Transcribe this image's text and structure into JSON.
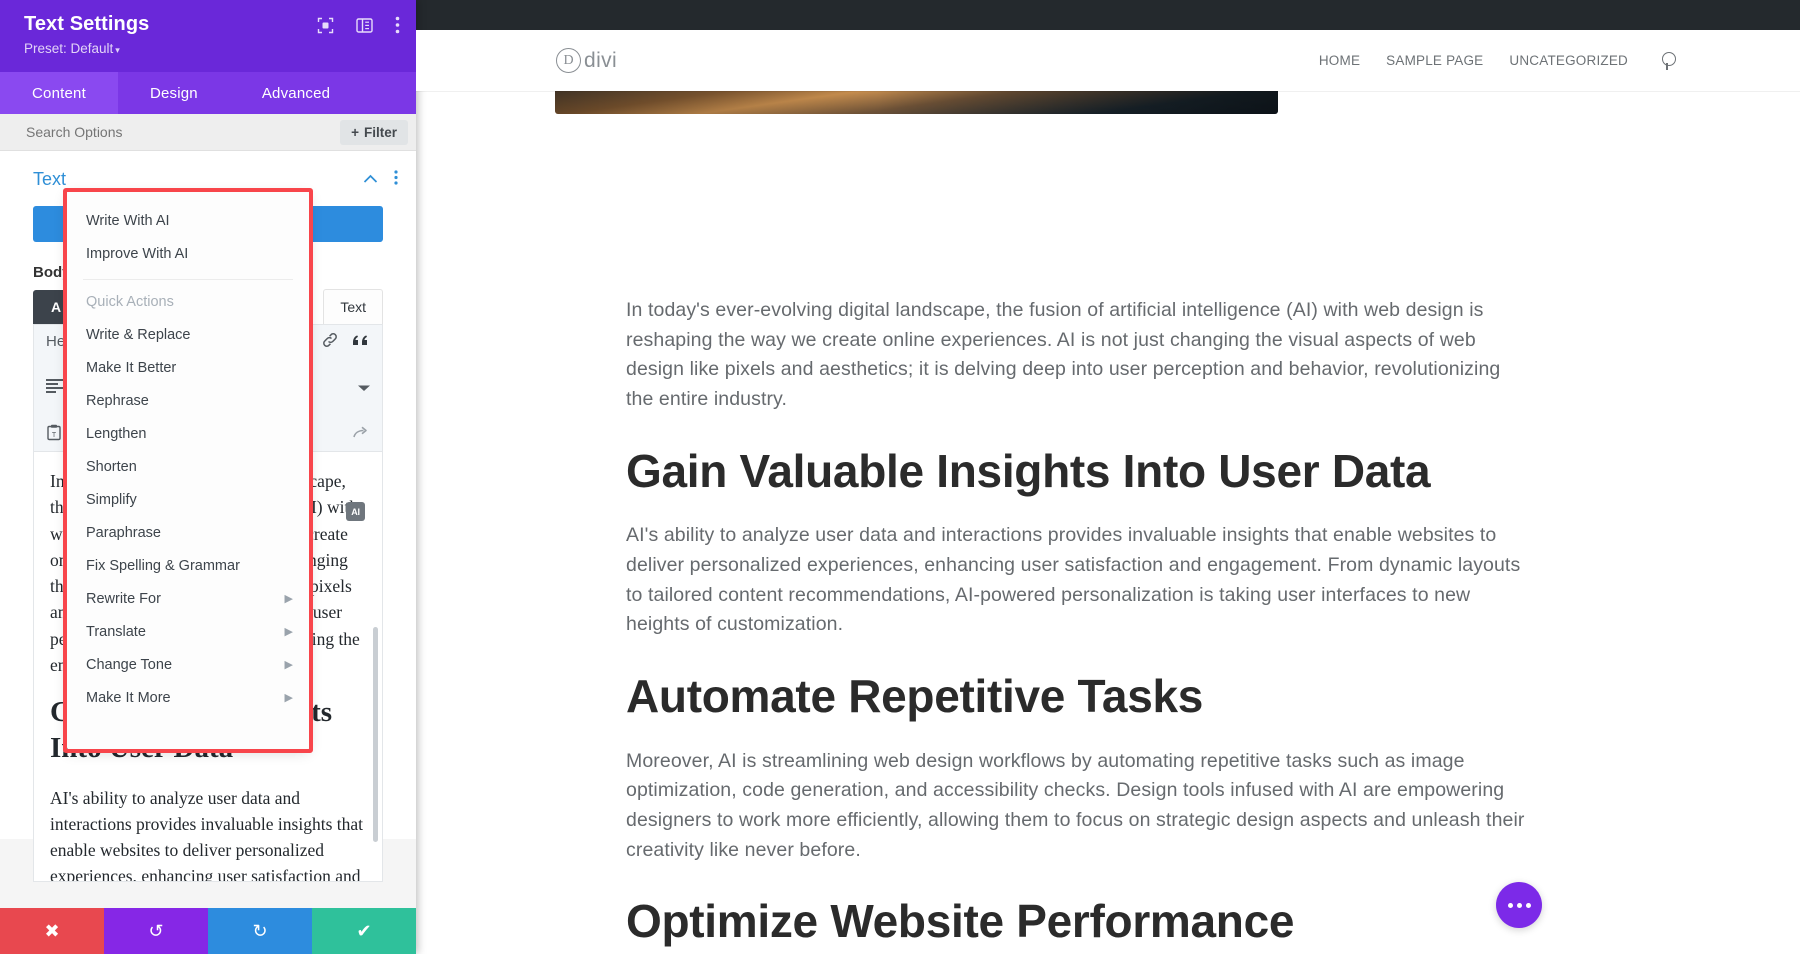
{
  "panel": {
    "title": "Text Settings",
    "preset": "Preset: Default",
    "preset_caret": "▾",
    "icons": {
      "focus": "focus-target-icon",
      "layout": "panel-layout-icon",
      "more": "more-vertical-icon"
    },
    "tabs": [
      {
        "label": "Content",
        "active": true
      },
      {
        "label": "Design",
        "active": false
      },
      {
        "label": "Advanced",
        "active": false
      }
    ],
    "search": {
      "placeholder": "Search Options",
      "value": ""
    },
    "filter_button": {
      "label": "Filter",
      "plus": "+"
    },
    "section": {
      "title": "Text",
      "collapse_icon": "chevron-up-icon",
      "more_icon": "more-vertical-icon"
    },
    "body_label": "Body",
    "tab_visual": "A",
    "tab_text": "Text",
    "heading_label": "He",
    "editor_toolbar_icons": [
      "align-left-icon",
      "link-icon",
      "quote-icon",
      "paste-as-text-icon",
      "chevron-down-icon",
      "redo-icon"
    ],
    "ai_chip_label": "AI",
    "editor_paragraph_1": "In today's ever-evolving digital landscape, the fusion of artificial intelligence (AI) with web design is reshaping the way we create online experiences. AI is not just changing the visual aspects of web design like pixels and aesthetics; it is delving deep into user perception and behavior, revolutionizing the entire industry.",
    "editor_heading_1": "Gain Valuable Insights Into User Data",
    "editor_paragraph_2": "AI's ability to analyze user data and interactions provides invaluable insights that enable websites to deliver personalized experiences, enhancing user satisfaction and engagement. From dynamic layouts to",
    "bottom_bar": [
      {
        "name": "cancel",
        "glyph": "✖",
        "color": "#E8484F"
      },
      {
        "name": "undo",
        "glyph": "↺",
        "color": "#8627E6"
      },
      {
        "name": "redo",
        "glyph": "↻",
        "color": "#2D8CDE"
      },
      {
        "name": "save",
        "glyph": "✔",
        "color": "#2FC19B"
      }
    ]
  },
  "ai_menu": {
    "primary": [
      {
        "label": "Write With AI",
        "submenu": false
      },
      {
        "label": "Improve With AI",
        "submenu": false
      }
    ],
    "group_label": "Quick Actions",
    "quick_actions": [
      {
        "label": "Write & Replace",
        "submenu": false
      },
      {
        "label": "Make It Better",
        "submenu": false
      },
      {
        "label": "Rephrase",
        "submenu": false
      },
      {
        "label": "Lengthen",
        "submenu": false
      },
      {
        "label": "Shorten",
        "submenu": false
      },
      {
        "label": "Simplify",
        "submenu": false
      },
      {
        "label": "Paraphrase",
        "submenu": false
      },
      {
        "label": "Fix Spelling & Grammar",
        "submenu": false
      },
      {
        "label": "Rewrite For",
        "submenu": true
      },
      {
        "label": "Translate",
        "submenu": true
      },
      {
        "label": "Change Tone",
        "submenu": true
      },
      {
        "label": "Make It More",
        "submenu": true
      }
    ],
    "submenu_arrow": "▶",
    "highlight_color": "#F8454B"
  },
  "site": {
    "logo_mark": "D",
    "logo_text": "divi",
    "nav": [
      {
        "label": "HOME"
      },
      {
        "label": "SAMPLE PAGE"
      },
      {
        "label": "UNCATEGORIZED"
      }
    ],
    "search_icon": "search-icon",
    "content": [
      {
        "type": "p",
        "text": "In today's ever-evolving digital landscape, the fusion of artificial intelligence (AI) with web design is reshaping the way we create online experiences. AI is not just changing the visual aspects of web design like pixels and aesthetics; it is delving deep into user perception and behavior, revolutionizing the entire industry."
      },
      {
        "type": "h2",
        "text": "Gain Valuable Insights Into User Data"
      },
      {
        "type": "p",
        "text": "AI's ability to analyze user data and interactions provides invaluable insights that enable websites to deliver personalized experiences, enhancing user satisfaction and engagement. From dynamic layouts to tailored content recommendations, AI-powered personalization is taking user interfaces to new heights of customization."
      },
      {
        "type": "h2",
        "text": "Automate Repetitive Tasks"
      },
      {
        "type": "p",
        "text": "Moreover, AI is streamlining web design workflows by automating repetitive tasks such as image optimization, code generation, and accessibility checks. Design tools infused with AI are empowering designers to work more efficiently, allowing them to focus on strategic design aspects and unleash their creativity like never before."
      },
      {
        "type": "h2",
        "text": "Optimize Website Performance"
      }
    ],
    "fab": {
      "name": "divi-ai-floating-button",
      "color": "#7C2AE8"
    }
  }
}
